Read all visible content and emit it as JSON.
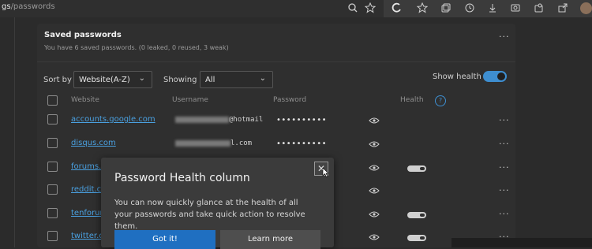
{
  "toolbar": {
    "url_host": "gs",
    "url_path": "/passwords",
    "icons": [
      "zoom-icon",
      "favorite-add-icon",
      "browser-essentials-icon",
      "favorites-icon",
      "collections-icon",
      "history-icon",
      "downloads-icon",
      "screenshot-icon",
      "extensions-icon",
      "share-icon",
      "profile-avatar"
    ]
  },
  "section": {
    "title": "Saved passwords",
    "subtitle": "You have 6 saved passwords. (0 leaked, 0 reused, 3 weak)",
    "more": "···"
  },
  "controls": {
    "sort_label": "Sort by",
    "sort_value": "Website(A-Z)",
    "showing_label": "Showing",
    "showing_value": "All",
    "show_health_label": "Show health",
    "show_health_on": true
  },
  "table": {
    "headers": {
      "website": "Website",
      "username": "Username",
      "password": "Password",
      "health": "Health",
      "help": "?"
    },
    "rows": [
      {
        "site": "accounts.google.com",
        "user": "@hotmail",
        "password": "••••••••••",
        "health": false,
        "more": "···"
      },
      {
        "site": "disqus.com",
        "user": "l.com",
        "password": "••••••••••",
        "health": false,
        "more": "···"
      },
      {
        "site": "forums.r",
        "user": "",
        "password": "",
        "health": true,
        "more": "···"
      },
      {
        "site": "reddit.c",
        "user": "",
        "password": "",
        "health": false,
        "more": "···"
      },
      {
        "site": "tenforum",
        "user": "",
        "password": "",
        "health": true,
        "more": "···"
      },
      {
        "site": "twitter.c",
        "user": "",
        "password": "",
        "health": true,
        "more": "···"
      }
    ]
  },
  "popup": {
    "title": "Password Health column",
    "text": "You can now quickly glance at the health of all your passwords and take quick action to resolve them.",
    "close": "✕",
    "got_it": "Got it!",
    "learn_more": "Learn more"
  },
  "colors": {
    "accent": "#3e8ed0",
    "link": "#4aa0e0",
    "primary_button": "#1f6fc1"
  }
}
